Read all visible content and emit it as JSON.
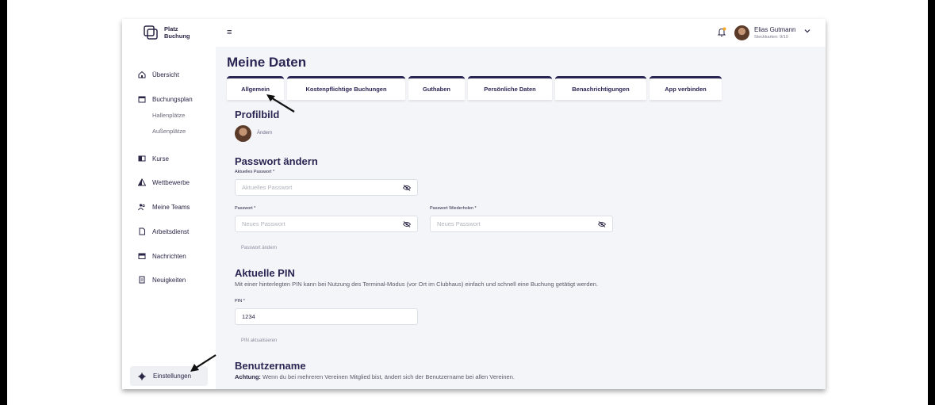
{
  "logo": {
    "line1": "Platz",
    "line2": "Buchung",
    "icon": "logo-icon"
  },
  "sidebar": {
    "items": [
      {
        "label": "Übersicht",
        "icon": "home-icon"
      },
      {
        "label": "Buchungsplan",
        "icon": "calendar-icon"
      },
      {
        "label": "Kurse",
        "icon": "flag-icon"
      },
      {
        "label": "Wettbewerbe",
        "icon": "triangle-icon"
      },
      {
        "label": "Meine Teams",
        "icon": "team-icon"
      },
      {
        "label": "Arbeitsdienst",
        "icon": "document-icon"
      },
      {
        "label": "Nachrichten",
        "icon": "mail-icon"
      },
      {
        "label": "Neuigkeiten",
        "icon": "news-icon"
      }
    ],
    "subitems": [
      "Hallenplätze",
      "Außenplätze"
    ],
    "settings": "Einstellungen"
  },
  "header": {
    "user_name": "Elias Gutmann",
    "user_sub": "Steckkarten: 9/10"
  },
  "page": {
    "title": "Meine Daten",
    "tabs": [
      "Allgemein",
      "Kostenpflichtige Buchungen",
      "Guthaben",
      "Persönliche Daten",
      "Benachrichtigungen",
      "App verbinden"
    ],
    "active_tab": "Allgemein"
  },
  "profile": {
    "title": "Profilbild",
    "change": "Ändern"
  },
  "password": {
    "title": "Passwort ändern",
    "current_label": "Aktuelles Passwort *",
    "current_placeholder": "Aktuelles Passwort",
    "new_label": "Passwort *",
    "new_placeholder": "Neues Passwort",
    "repeat_label": "Passwort Wiederholen *",
    "repeat_placeholder": "Neues Passwort",
    "button": "Passwort ändern"
  },
  "pin": {
    "title": "Aktuelle PIN",
    "description": "Mit einer hinterlegten PIN kann bei Nutzung des Terminal-Modus (vor Ort im Clubhaus) einfach und schnell eine Buchung getätigt werden.",
    "label": "PIN *",
    "value": "1234",
    "button": "PIN aktualisieren"
  },
  "username": {
    "title": "Benutzername",
    "warning_bold": "Achtung:",
    "warning_text": " Wenn du bei mehreren Vereinen Mitglied bist, ändert sich der Benutzername bei allen Vereinen."
  },
  "colors": {
    "primary": "#2a2553",
    "background": "#f4f5f8",
    "notification": "#f5a623"
  }
}
